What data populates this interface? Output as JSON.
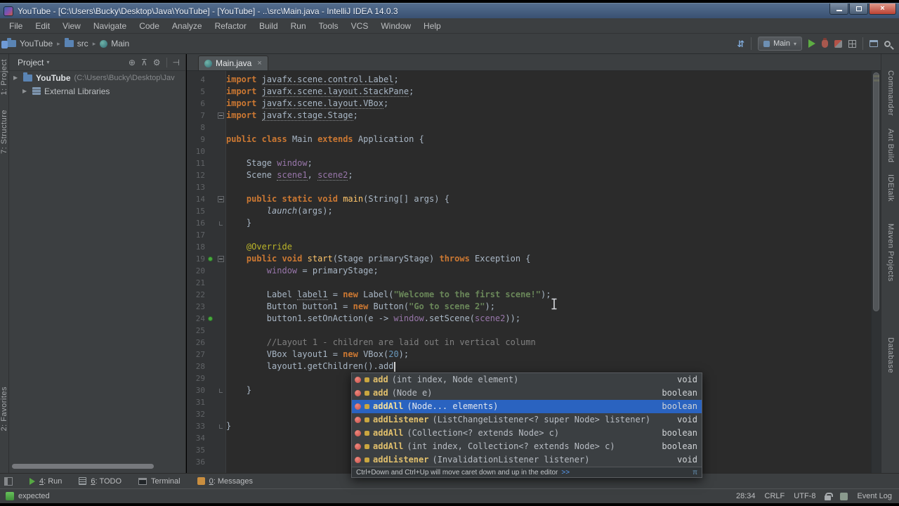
{
  "window": {
    "title": "YouTube - [C:\\Users\\Bucky\\Desktop\\Java\\YouTube] - [YouTube] - ..\\src\\Main.java - IntelliJ IDEA 14.0.3"
  },
  "menu": {
    "items": [
      "File",
      "Edit",
      "View",
      "Navigate",
      "Code",
      "Analyze",
      "Refactor",
      "Build",
      "Run",
      "Tools",
      "VCS",
      "Window",
      "Help"
    ]
  },
  "toolbar": {
    "breadcrumbs": [
      {
        "label": "YouTube",
        "icon": "folder"
      },
      {
        "label": "src",
        "icon": "folder"
      },
      {
        "label": "Main",
        "icon": "class"
      }
    ],
    "run_config": "Main"
  },
  "left_stripe": {
    "items": [
      "1: Project",
      "7: Structure",
      "2: Favorites"
    ]
  },
  "right_stripe": {
    "items": [
      "Commander",
      "Ant Build",
      "IDEtalk",
      "Maven Projects",
      "Database"
    ]
  },
  "project_panel": {
    "header": "Project",
    "tree": [
      {
        "name": "YouTube",
        "path": " (C:\\Users\\Bucky\\Desktop\\Jav",
        "icon": "folder",
        "indent": 0
      },
      {
        "name": "External Libraries",
        "path": "",
        "icon": "library",
        "indent": 1
      }
    ]
  },
  "editor": {
    "tab_label": "Main.java",
    "lines": [
      {
        "n": 4,
        "seg": [
          [
            "kw",
            "import"
          ],
          [
            "id",
            " "
          ],
          [
            "idu",
            "javafx.scene.control.Label"
          ],
          [
            "id",
            ";"
          ]
        ]
      },
      {
        "n": 5,
        "seg": [
          [
            "kw",
            "import"
          ],
          [
            "id",
            " "
          ],
          [
            "idu",
            "javafx.scene.layout.StackPane"
          ],
          [
            "id",
            ";"
          ]
        ]
      },
      {
        "n": 6,
        "seg": [
          [
            "kw",
            "import"
          ],
          [
            "id",
            " "
          ],
          [
            "idu",
            "javafx.scene.layout.VBox"
          ],
          [
            "id",
            ";"
          ]
        ]
      },
      {
        "n": 7,
        "fold": "m",
        "seg": [
          [
            "kw",
            "import"
          ],
          [
            "id",
            " "
          ],
          [
            "idu",
            "javafx.stage.Stage"
          ],
          [
            "id",
            ";"
          ]
        ]
      },
      {
        "n": 8,
        "seg": []
      },
      {
        "n": 9,
        "seg": [
          [
            "kw",
            "public"
          ],
          [
            "id",
            " "
          ],
          [
            "kw",
            "class"
          ],
          [
            "id",
            " Main "
          ],
          [
            "kw",
            "extends"
          ],
          [
            "id",
            " Application {"
          ]
        ]
      },
      {
        "n": 10,
        "seg": []
      },
      {
        "n": 11,
        "seg": [
          [
            "id",
            "    Stage "
          ],
          [
            "fld",
            "window"
          ],
          [
            "id",
            ";"
          ]
        ]
      },
      {
        "n": 12,
        "seg": [
          [
            "id",
            "    Scene "
          ],
          [
            "fldu",
            "scene1"
          ],
          [
            "id",
            ", "
          ],
          [
            "fldu",
            "scene2"
          ],
          [
            "id",
            ";"
          ]
        ]
      },
      {
        "n": 13,
        "seg": []
      },
      {
        "n": 14,
        "fold": "m",
        "seg": [
          [
            "id",
            "    "
          ],
          [
            "kw",
            "public static void"
          ],
          [
            "id",
            " "
          ],
          [
            "mth",
            "main"
          ],
          [
            "id",
            "(String[] args) {"
          ]
        ]
      },
      {
        "n": 15,
        "seg": [
          [
            "id",
            "        "
          ],
          [
            "stat",
            "launch"
          ],
          [
            "id",
            "(args);"
          ]
        ]
      },
      {
        "n": 16,
        "fold": "e",
        "seg": [
          [
            "id",
            "    }"
          ]
        ]
      },
      {
        "n": 17,
        "seg": []
      },
      {
        "n": 18,
        "seg": [
          [
            "id",
            "    "
          ],
          [
            "ann",
            "@Override"
          ]
        ]
      },
      {
        "n": 19,
        "fold": "m",
        "dot": true,
        "seg": [
          [
            "id",
            "    "
          ],
          [
            "kw",
            "public void"
          ],
          [
            "id",
            " "
          ],
          [
            "mth",
            "start"
          ],
          [
            "id",
            "(Stage primaryStage) "
          ],
          [
            "kw",
            "throws"
          ],
          [
            "id",
            " Exception {"
          ]
        ]
      },
      {
        "n": 20,
        "seg": [
          [
            "id",
            "        "
          ],
          [
            "fld",
            "window"
          ],
          [
            "id",
            " = primaryStage;"
          ]
        ]
      },
      {
        "n": 21,
        "seg": []
      },
      {
        "n": 22,
        "seg": [
          [
            "id",
            "        Label "
          ],
          [
            "idu",
            "label1"
          ],
          [
            "id",
            " = "
          ],
          [
            "kw",
            "new"
          ],
          [
            "id",
            " Label("
          ],
          [
            "str",
            "\"Welcome to the first scene!\""
          ],
          [
            "id",
            ");"
          ]
        ]
      },
      {
        "n": 23,
        "seg": [
          [
            "id",
            "        Button button1 = "
          ],
          [
            "kw",
            "new"
          ],
          [
            "id",
            " Button("
          ],
          [
            "str",
            "\"Go to scene 2\""
          ],
          [
            "id",
            ");"
          ]
        ]
      },
      {
        "n": 24,
        "dot": true,
        "seg": [
          [
            "id",
            "        button1.setOnAction(e -> "
          ],
          [
            "fld",
            "window"
          ],
          [
            "id",
            ".setScene("
          ],
          [
            "fld",
            "scene2"
          ],
          [
            "id",
            "));"
          ]
        ]
      },
      {
        "n": 25,
        "seg": []
      },
      {
        "n": 26,
        "seg": [
          [
            "cmt",
            "        //Layout 1 - children are laid out in vertical column"
          ]
        ]
      },
      {
        "n": 27,
        "seg": [
          [
            "id",
            "        VBox layout1 = "
          ],
          [
            "kw",
            "new"
          ],
          [
            "id",
            " VBox("
          ],
          [
            "num",
            "20"
          ],
          [
            "id",
            ");"
          ]
        ]
      },
      {
        "n": 28,
        "caret": true,
        "seg": [
          [
            "id",
            "        layout1.getChildren().add"
          ]
        ]
      },
      {
        "n": 29,
        "seg": []
      },
      {
        "n": 30,
        "fold": "e",
        "seg": [
          [
            "id",
            "    }"
          ]
        ]
      },
      {
        "n": 31,
        "seg": []
      },
      {
        "n": 32,
        "seg": []
      },
      {
        "n": 33,
        "fold": "e",
        "seg": [
          [
            "id",
            "}"
          ]
        ]
      },
      {
        "n": 34,
        "seg": []
      },
      {
        "n": 35,
        "seg": []
      },
      {
        "n": 36,
        "seg": []
      }
    ]
  },
  "completion": {
    "items": [
      {
        "name": "add",
        "params": "(int index, Node element)",
        "ret": "void",
        "selected": false
      },
      {
        "name": "add",
        "params": "(Node e)",
        "ret": "boolean",
        "selected": false
      },
      {
        "name": "addAll",
        "params": "(Node... elements)",
        "ret": "boolean",
        "selected": true
      },
      {
        "name": "addListener",
        "params": "(ListChangeListener<? super Node> listener)",
        "ret": "void",
        "selected": false
      },
      {
        "name": "addAll",
        "params": "(Collection<? extends Node> c)",
        "ret": "boolean",
        "selected": false
      },
      {
        "name": "addAll",
        "params": "(int index, Collection<? extends Node> c)",
        "ret": "boolean",
        "selected": false
      },
      {
        "name": "addListener",
        "params": "(InvalidationListener listener)",
        "ret": "void",
        "selected": false
      }
    ],
    "hint_text": "Ctrl+Down and Ctrl+Up will move caret down and up in the editor",
    "hint_link": ">>"
  },
  "bottom_bar": {
    "items": [
      {
        "mnemonic": "4",
        "label": ": Run",
        "icon": "run"
      },
      {
        "mnemonic": "6",
        "label": ": TODO",
        "icon": "todo"
      },
      {
        "mnem_note": "",
        "mnemonic": "",
        "label": "Terminal",
        "icon": "terminal"
      },
      {
        "mnemonic": "0",
        "label": ": Messages",
        "icon": "messages"
      }
    ]
  },
  "status_bar": {
    "message": "expected",
    "caret_position": "28:34",
    "line_ending": "CRLF",
    "encoding": "UTF-8",
    "event_log_label": "Event Log"
  },
  "icons": {
    "breadcrumb_sep": "▸",
    "chevron_down": "▾",
    "tree_arrow": "▶",
    "scroll_from_source": "⊕",
    "collapse_all": "⊼",
    "settings_gear": "⚙",
    "hide_panel": "⊣",
    "vcs_update": "⇵",
    "tab_close": "×",
    "window_close": "×",
    "popup_corner": "π"
  },
  "colors": {
    "panel_bg": "#3c3f41",
    "editor_bg": "#2b2b2b",
    "gutter_bg": "#313335",
    "selection_blue": "#2a63c0",
    "keyword_orange": "#cc7832",
    "string_green": "#6a8759",
    "field_purple": "#9876aa",
    "number_blue": "#6897bb",
    "comment_gray": "#808080",
    "annotation_yellow": "#bbb529",
    "method_yellow": "#ffc66b",
    "titlebar_blue": "#44597a",
    "run_green": "#56a843",
    "close_red": "#bb4233"
  }
}
